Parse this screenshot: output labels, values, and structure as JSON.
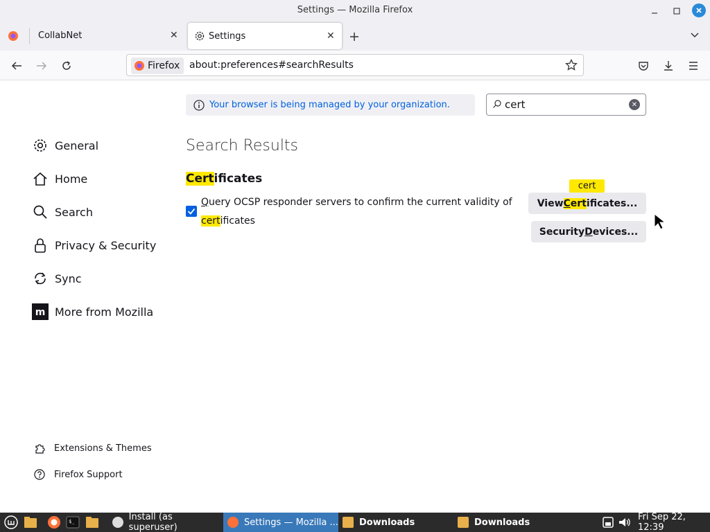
{
  "window": {
    "title": "Settings — Mozilla Firefox"
  },
  "tabs": [
    {
      "label": "CollabNet",
      "active": false
    },
    {
      "label": "Settings",
      "active": true
    }
  ],
  "urlbar": {
    "identity_label": "Firefox",
    "url": "about:preferences#searchResults"
  },
  "policy_notice": "Your browser is being managed by your organization.",
  "search": {
    "value": "cert"
  },
  "sidebar": {
    "items": [
      {
        "label": "General",
        "icon": "gear-icon"
      },
      {
        "label": "Home",
        "icon": "home-icon"
      },
      {
        "label": "Search",
        "icon": "search-icon"
      },
      {
        "label": "Privacy & Security",
        "icon": "lock-icon"
      },
      {
        "label": "Sync",
        "icon": "sync-icon"
      },
      {
        "label": "More from Mozilla",
        "icon": "mozilla-icon"
      }
    ],
    "footer": [
      {
        "label": "Extensions & Themes",
        "icon": "puzzle-icon"
      },
      {
        "label": "Firefox Support",
        "icon": "help-icon"
      }
    ]
  },
  "main": {
    "heading": "Search Results",
    "section": {
      "title_hl": "Cert",
      "title_rest": "ificates"
    },
    "ocsp": {
      "checked": true,
      "line1_hotkey": "Q",
      "line1_rest": "uery OCSP responder servers to confirm the current validity of",
      "line2_hl": "cert",
      "line2_rest": "ificates"
    },
    "buttons": {
      "view_pre": "View ",
      "view_hotkey": "C",
      "view_hl_rest": "ert",
      "view_post": "ificates...",
      "tooltip": "cert",
      "devices_pre": "Security ",
      "devices_hotkey": "D",
      "devices_post": "evices..."
    }
  },
  "taskbar": {
    "tasks": [
      {
        "label": "Install (as superuser)",
        "active": false
      },
      {
        "label": "Settings — Mozilla ...",
        "active": true
      },
      {
        "label": "Downloads",
        "active": false
      },
      {
        "label": "Downloads",
        "active": false
      }
    ],
    "clock": "Fri Sep 22, 12:39"
  },
  "colors": {
    "accent": "#0060df",
    "highlight": "#ffe900",
    "taskbar_active": "#3a79b9"
  }
}
